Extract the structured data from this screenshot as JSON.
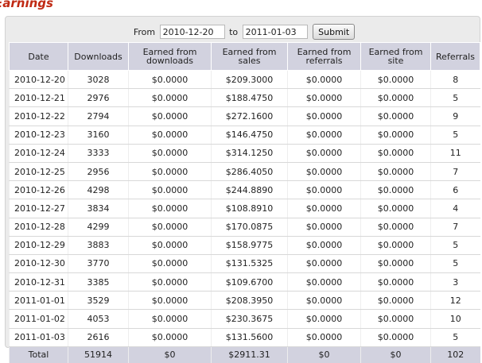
{
  "page": {
    "title": "Earnings"
  },
  "filter": {
    "from_label": "From",
    "from_value": "2010-12-20",
    "to_label": "to",
    "to_value": "2011-01-03",
    "submit_label": "Submit"
  },
  "table": {
    "headers": [
      "Date",
      "Downloads",
      "Earned from downloads",
      "Earned from sales",
      "Earned from referrals",
      "Earned from site",
      "Referrals"
    ],
    "rows": [
      [
        "2010-12-20",
        "3028",
        "$0.0000",
        "$209.3000",
        "$0.0000",
        "$0.0000",
        "8"
      ],
      [
        "2010-12-21",
        "2976",
        "$0.0000",
        "$188.4750",
        "$0.0000",
        "$0.0000",
        "5"
      ],
      [
        "2010-12-22",
        "2794",
        "$0.0000",
        "$272.1600",
        "$0.0000",
        "$0.0000",
        "9"
      ],
      [
        "2010-12-23",
        "3160",
        "$0.0000",
        "$146.4750",
        "$0.0000",
        "$0.0000",
        "5"
      ],
      [
        "2010-12-24",
        "3333",
        "$0.0000",
        "$314.1250",
        "$0.0000",
        "$0.0000",
        "11"
      ],
      [
        "2010-12-25",
        "2956",
        "$0.0000",
        "$286.4050",
        "$0.0000",
        "$0.0000",
        "7"
      ],
      [
        "2010-12-26",
        "4298",
        "$0.0000",
        "$244.8890",
        "$0.0000",
        "$0.0000",
        "6"
      ],
      [
        "2010-12-27",
        "3834",
        "$0.0000",
        "$108.8910",
        "$0.0000",
        "$0.0000",
        "4"
      ],
      [
        "2010-12-28",
        "4299",
        "$0.0000",
        "$170.0875",
        "$0.0000",
        "$0.0000",
        "7"
      ],
      [
        "2010-12-29",
        "3883",
        "$0.0000",
        "$158.9775",
        "$0.0000",
        "$0.0000",
        "5"
      ],
      [
        "2010-12-30",
        "3770",
        "$0.0000",
        "$131.5325",
        "$0.0000",
        "$0.0000",
        "5"
      ],
      [
        "2010-12-31",
        "3385",
        "$0.0000",
        "$109.6700",
        "$0.0000",
        "$0.0000",
        "3"
      ],
      [
        "2011-01-01",
        "3529",
        "$0.0000",
        "$208.3950",
        "$0.0000",
        "$0.0000",
        "12"
      ],
      [
        "2011-01-02",
        "4053",
        "$0.0000",
        "$230.3675",
        "$0.0000",
        "$0.0000",
        "10"
      ],
      [
        "2011-01-03",
        "2616",
        "$0.0000",
        "$131.5600",
        "$0.0000",
        "$0.0000",
        "5"
      ]
    ],
    "total": [
      "Total",
      "51914",
      "$0",
      "$2911.31",
      "$0",
      "$0",
      "102"
    ]
  }
}
